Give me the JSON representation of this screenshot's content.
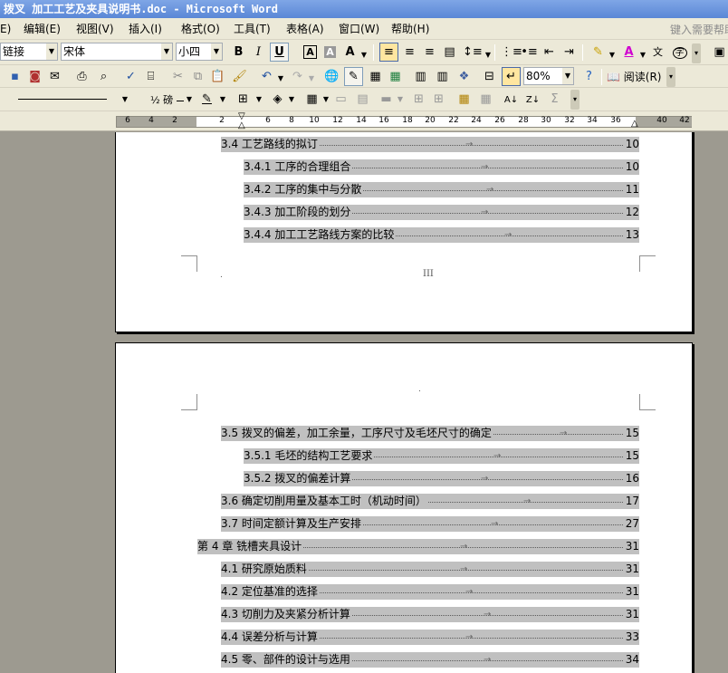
{
  "window": {
    "title": "拨叉 加工工艺及夹具说明书.doc - Microsoft Word"
  },
  "menu": {
    "items": [
      {
        "label": "E)"
      },
      {
        "label": "编辑(E)"
      },
      {
        "label": "视图(V)"
      },
      {
        "label": "插入(I)"
      },
      {
        "label": "格式(O)"
      },
      {
        "label": "工具(T)"
      },
      {
        "label": "表格(A)"
      },
      {
        "label": "窗口(W)"
      },
      {
        "label": "帮助(H)"
      }
    ],
    "help_placeholder": "键入需要帮助"
  },
  "toolbar_formatting": {
    "style_value": "链接",
    "font_value": "宋体",
    "size_value": "小四",
    "bold": "B",
    "italic": "I",
    "underline": "U"
  },
  "toolbar_standard": {
    "zoom_value": "80%",
    "read_label": "阅读(R)"
  },
  "toolbar_drawing": {
    "line_weight": "½ 磅"
  },
  "ruler": {
    "numbers": [
      "6",
      "4",
      "2",
      "2",
      "6",
      "8",
      "10",
      "12",
      "14",
      "16",
      "18",
      "20",
      "22",
      "24",
      "26",
      "28",
      "30",
      "32",
      "34",
      "36",
      "40",
      "42"
    ]
  },
  "page1": {
    "toc": [
      {
        "label": "3.4 工艺路线的拟订",
        "page": "10"
      },
      {
        "label": "3.4.1 工序的合理组合",
        "page": "10"
      },
      {
        "label": "3.4.2 工序的集中与分散",
        "page": "11"
      },
      {
        "label": "3.4.3 加工阶段的划分",
        "page": "12"
      },
      {
        "label": "3.4.4 加工工艺路线方案的比较",
        "page": "13"
      }
    ],
    "page_number": "III"
  },
  "page2": {
    "toc": [
      {
        "label": "3.5 拨叉的偏差，加工余量，工序尺寸及毛坯尺寸的确定",
        "page": "15"
      },
      {
        "label": "3.5.1 毛坯的结构工艺要求",
        "page": "15"
      },
      {
        "label": "3.5.2 拨叉的偏差计算",
        "page": "16"
      },
      {
        "label": "3.6 确定切削用量及基本工时（机动时间）",
        "page": "17"
      },
      {
        "label": "3.7 时间定额计算及生产安排",
        "page": "27"
      },
      {
        "label": "第 4 章  铣槽夹具设计",
        "page": "31"
      },
      {
        "label": "4.1 研究原始质料",
        "page": "31"
      },
      {
        "label": "4.2 定位基准的选择",
        "page": "31"
      },
      {
        "label": "4.3  切削力及夹紧分析计算",
        "page": "31"
      },
      {
        "label": "4.4  误差分析与计算",
        "page": "33"
      },
      {
        "label": "4.5  零、部件的设计与选用",
        "page": "34"
      }
    ]
  }
}
